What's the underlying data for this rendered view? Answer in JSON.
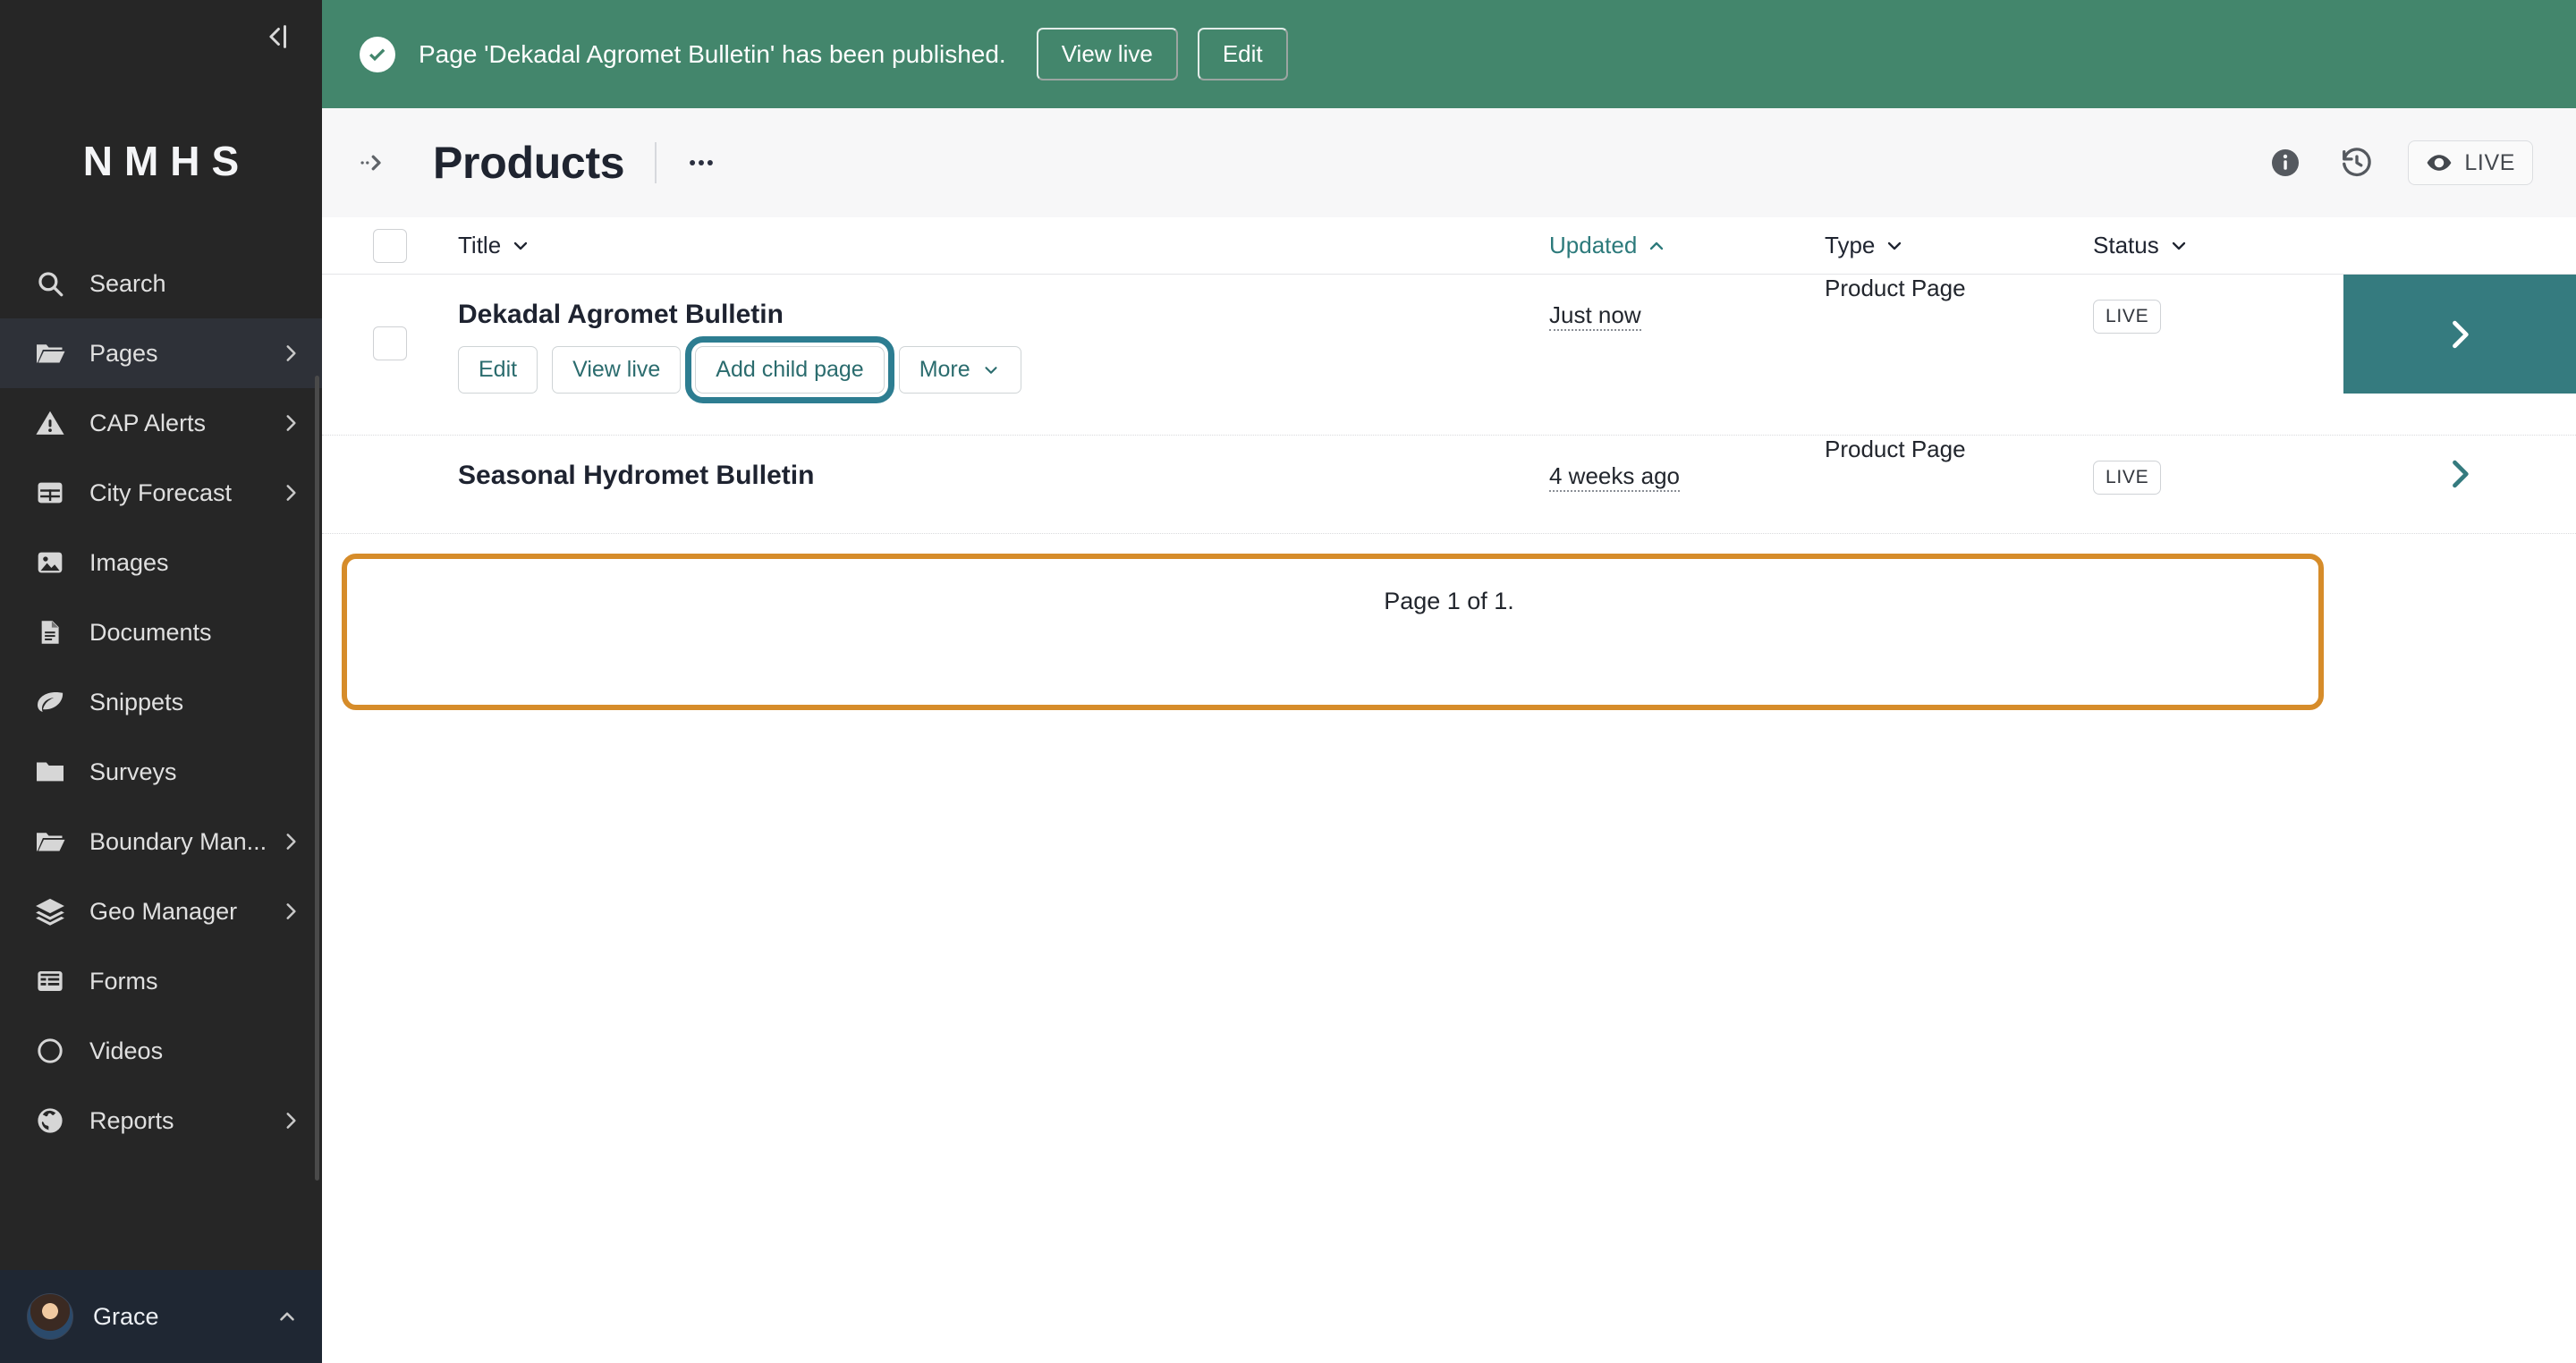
{
  "sidebar": {
    "logo": "NMHS",
    "collapse_icon": "collapse-sidebar-icon",
    "items": [
      {
        "label": "Search",
        "icon": "search-icon",
        "expandable": false,
        "active": false
      },
      {
        "label": "Pages",
        "icon": "folder-open-icon",
        "expandable": true,
        "active": true
      },
      {
        "label": "CAP Alerts",
        "icon": "warning-icon",
        "expandable": true,
        "active": false
      },
      {
        "label": "City Forecast",
        "icon": "table-icon",
        "expandable": true,
        "active": false
      },
      {
        "label": "Images",
        "icon": "image-icon",
        "expandable": false,
        "active": false
      },
      {
        "label": "Documents",
        "icon": "document-icon",
        "expandable": false,
        "active": false
      },
      {
        "label": "Snippets",
        "icon": "leaf-icon",
        "expandable": false,
        "active": false
      },
      {
        "label": "Surveys",
        "icon": "folder-icon",
        "expandable": false,
        "active": false
      },
      {
        "label": "Boundary Man...",
        "icon": "folder-open-icon",
        "expandable": true,
        "active": false
      },
      {
        "label": "Geo Manager",
        "icon": "layers-icon",
        "expandable": true,
        "active": false
      },
      {
        "label": "Forms",
        "icon": "list-icon",
        "expandable": false,
        "active": false
      },
      {
        "label": "Videos",
        "icon": "circle-icon",
        "expandable": false,
        "active": false
      },
      {
        "label": "Reports",
        "icon": "globe-icon",
        "expandable": true,
        "active": false
      }
    ],
    "footer": {
      "name": "Grace",
      "chevron": "chevron-up-icon",
      "avatar": "user-avatar"
    }
  },
  "banner": {
    "message": "Page 'Dekadal Agromet Bulletin' has been published.",
    "icon": "success-check-icon",
    "view_live_label": "View live",
    "edit_label": "Edit",
    "bg_color": "#43866c"
  },
  "header": {
    "breadcrumb_icon": "breadcrumb-expand-icon",
    "title": "Products",
    "more_icon": "ellipsis-icon",
    "info_icon": "info-icon",
    "history_icon": "history-icon",
    "live_label": "LIVE",
    "live_icon": "eye-icon"
  },
  "table": {
    "columns": [
      {
        "key": "title",
        "label": "Title",
        "sorted": false,
        "sort_icon": "chevron-down-icon"
      },
      {
        "key": "upd",
        "label": "Updated",
        "sorted": true,
        "sort_icon": "chevron-up-icon"
      },
      {
        "key": "type",
        "label": "Type",
        "sorted": false,
        "sort_icon": "chevron-down-icon"
      },
      {
        "key": "status",
        "label": "Status",
        "sorted": false,
        "sort_icon": "chevron-down-icon"
      }
    ],
    "rows": [
      {
        "title": "Dekadal Agromet Bulletin",
        "updated": "Just now",
        "type": "Product Page",
        "status": "LIVE",
        "highlighted": true,
        "actions": [
          {
            "label": "Edit",
            "focused": false,
            "dropdown": false
          },
          {
            "label": "View live",
            "focused": false,
            "dropdown": false
          },
          {
            "label": "Add child page",
            "focused": true,
            "dropdown": false
          },
          {
            "label": "More",
            "focused": false,
            "dropdown": true
          }
        ]
      },
      {
        "title": "Seasonal Hydromet Bulletin",
        "updated": "4 weeks ago",
        "type": "Product Page",
        "status": "LIVE",
        "highlighted": false,
        "actions": []
      }
    ],
    "pagination": "Page 1 of 1."
  },
  "colors": {
    "banner_green": "#43866c",
    "sidebar_dark": "#262626",
    "focus_orange": "#d68c2a",
    "focus_teal": "#2d7d91",
    "arrow_teal": "#357b7f",
    "link_teal": "#2c7a7b"
  }
}
